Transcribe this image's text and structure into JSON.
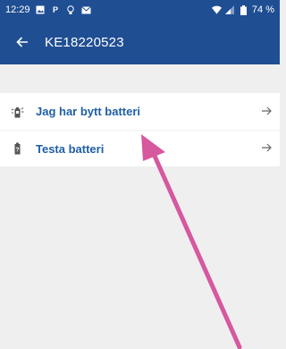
{
  "status_bar": {
    "time": "12:29",
    "battery_percent": "74 %"
  },
  "app_bar": {
    "title": "KE18220523",
    "back_icon": "arrow-left-icon"
  },
  "list": {
    "items": [
      {
        "label": "Jag har bytt batteri",
        "icon": "battery-change-icon",
        "action_icon": "arrow-right-icon"
      },
      {
        "label": "Testa batteri",
        "icon": "battery-test-icon",
        "action_icon": "arrow-right-icon"
      }
    ]
  },
  "colors": {
    "primary": "#1f4e93",
    "link": "#1f5ea8",
    "background": "#efefef",
    "annotation_arrow": "#d6589e"
  }
}
